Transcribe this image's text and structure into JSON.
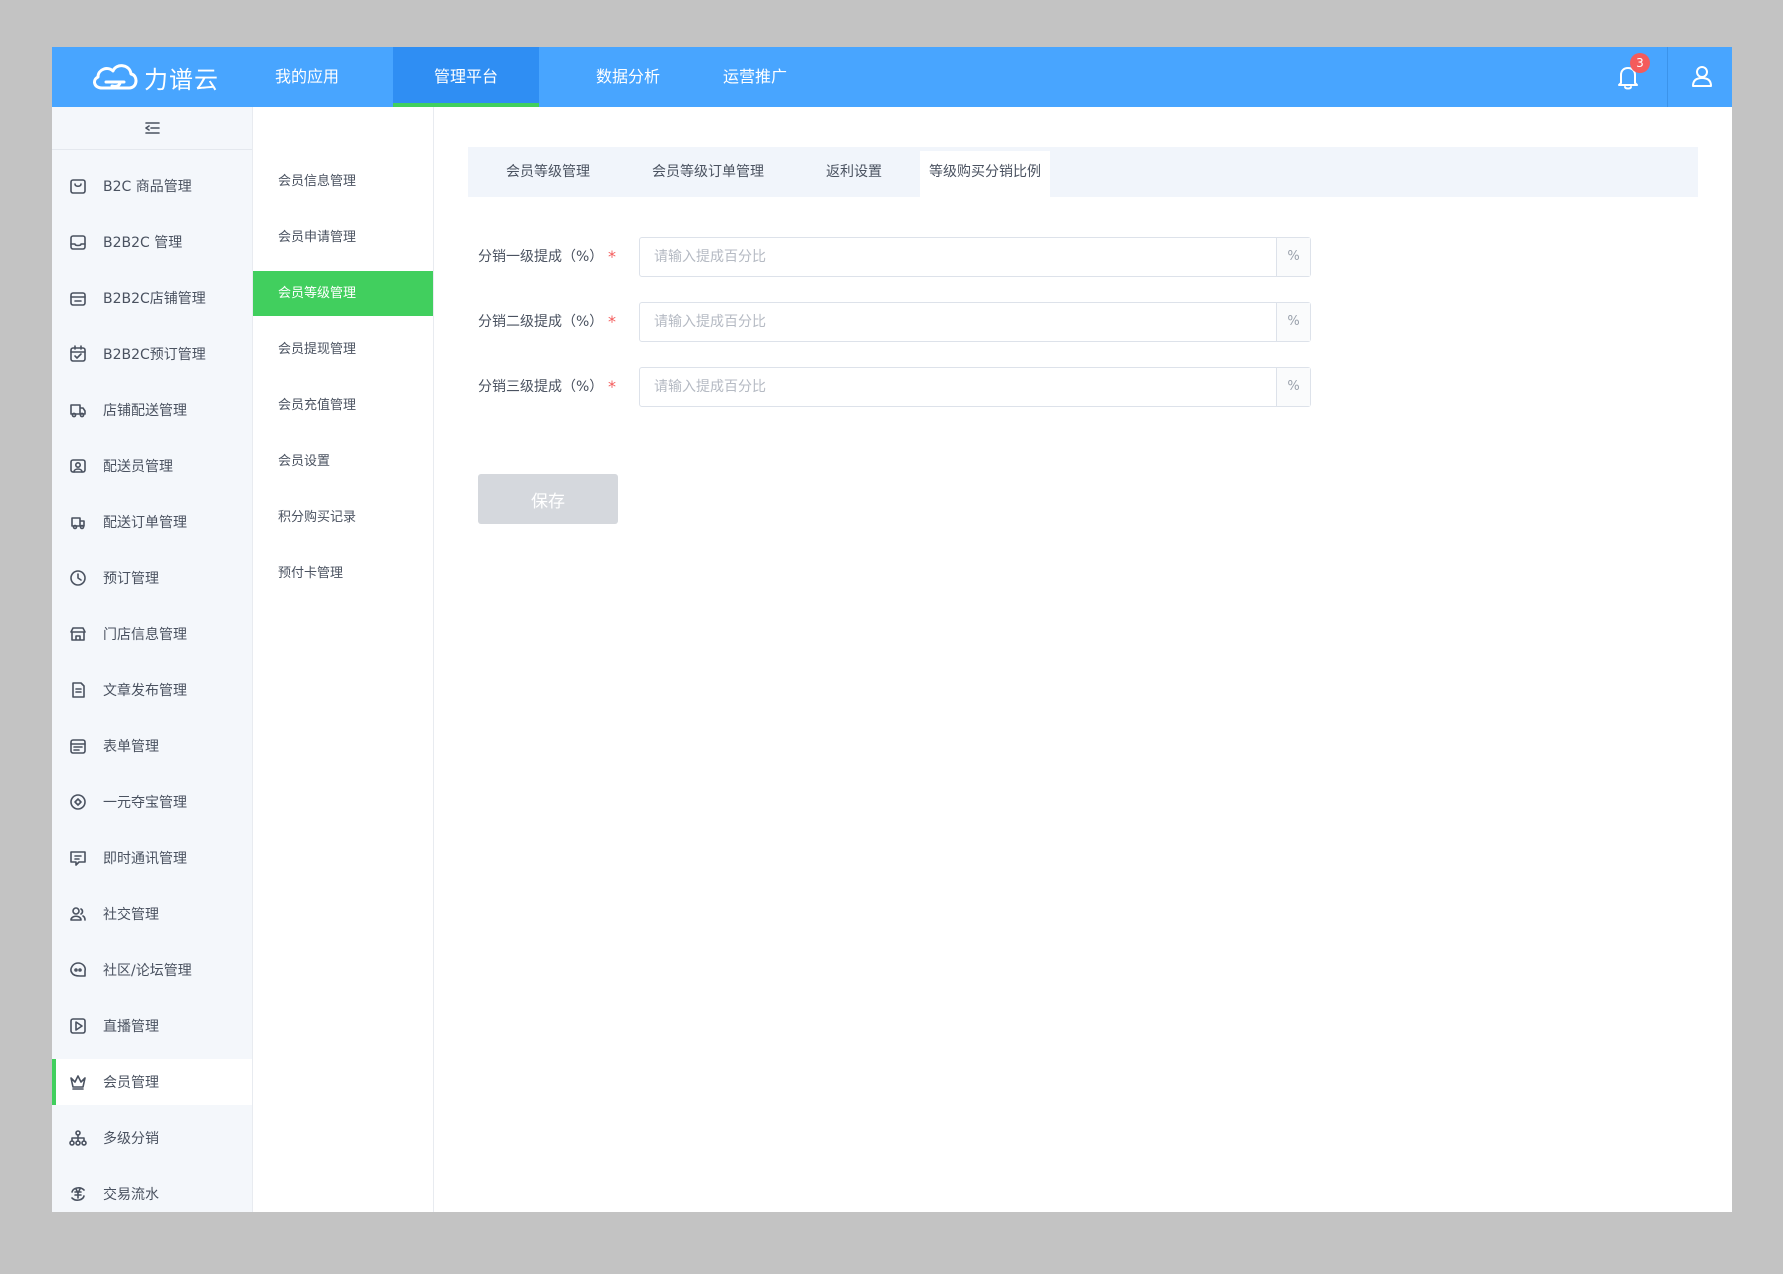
{
  "brand": {
    "logo_text": "力谱云"
  },
  "topnav": {
    "items": [
      {
        "label": "我的应用"
      },
      {
        "label": "管理平台"
      },
      {
        "label": "数据分析"
      },
      {
        "label": "运营推广"
      }
    ],
    "active_index": 1
  },
  "notifications": {
    "count": "3"
  },
  "colors": {
    "primary": "#48a5ff",
    "accent_green": "#41cf5e",
    "required": "#f45b5b"
  },
  "sidebar": {
    "items": [
      {
        "label": "B2C 商品管理",
        "icon": "shopping-bag-icon"
      },
      {
        "label": "B2B2C 管理",
        "icon": "inbox-icon"
      },
      {
        "label": "B2B2C店铺管理",
        "icon": "store-icon"
      },
      {
        "label": "B2B2C预订管理",
        "icon": "calendar-check-icon"
      },
      {
        "label": "店铺配送管理",
        "icon": "delivery-truck-icon"
      },
      {
        "label": "配送员管理",
        "icon": "courier-icon"
      },
      {
        "label": "配送订单管理",
        "icon": "delivery-order-icon"
      },
      {
        "label": "预订管理",
        "icon": "clock-icon"
      },
      {
        "label": "门店信息管理",
        "icon": "shop-icon"
      },
      {
        "label": "文章发布管理",
        "icon": "document-icon"
      },
      {
        "label": "表单管理",
        "icon": "form-icon"
      },
      {
        "label": "一元夺宝管理",
        "icon": "target-icon"
      },
      {
        "label": "即时通讯管理",
        "icon": "chat-icon"
      },
      {
        "label": "社交管理",
        "icon": "users-icon"
      },
      {
        "label": "社区/论坛管理",
        "icon": "forum-icon"
      },
      {
        "label": "直播管理",
        "icon": "play-icon"
      },
      {
        "label": "会员管理",
        "icon": "crown-icon"
      },
      {
        "label": "多级分销",
        "icon": "hierarchy-icon"
      },
      {
        "label": "交易流水",
        "icon": "currency-cycle-icon"
      }
    ],
    "active_index": 16
  },
  "subnav": {
    "items": [
      {
        "label": "会员信息管理"
      },
      {
        "label": "会员申请管理"
      },
      {
        "label": "会员等级管理"
      },
      {
        "label": "会员提现管理"
      },
      {
        "label": "会员充值管理"
      },
      {
        "label": "会员设置"
      },
      {
        "label": "积分购买记录"
      },
      {
        "label": "预付卡管理"
      }
    ],
    "active_index": 2
  },
  "tabs": {
    "items": [
      {
        "label": "会员等级管理"
      },
      {
        "label": "会员等级订单管理"
      },
      {
        "label": "返利设置"
      },
      {
        "label": "等级购买分销比例"
      }
    ],
    "active_index": 3
  },
  "form": {
    "fields": [
      {
        "label": "分销一级提成（%）",
        "required": "*",
        "placeholder": "请输入提成百分比",
        "value": "",
        "suffix": "%"
      },
      {
        "label": "分销二级提成（%）",
        "required": "*",
        "placeholder": "请输入提成百分比",
        "value": "",
        "suffix": "%"
      },
      {
        "label": "分销三级提成（%）",
        "required": "*",
        "placeholder": "请输入提成百分比",
        "value": "",
        "suffix": "%"
      }
    ],
    "save_label": "保存"
  }
}
